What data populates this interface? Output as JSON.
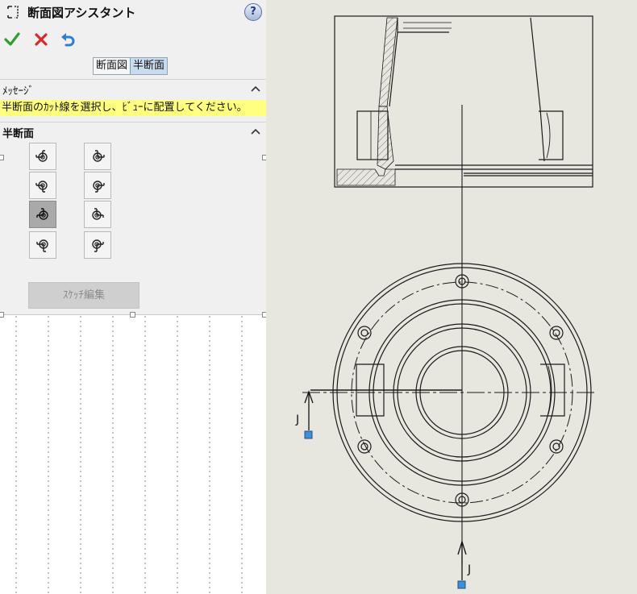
{
  "dialog": {
    "title": "断面図アシスタント",
    "help_symbol": "?",
    "tabs": [
      "断面図",
      "半断面"
    ],
    "active_tab_index": 1
  },
  "message_section": {
    "header": "ﾒｯｾｰｼﾞ",
    "text": "半断面のｶｯﾄ線を選択し、ﾋﾞｭｰに配置してください。"
  },
  "half_section": {
    "header": "半断面",
    "icon_buttons": [
      {
        "name": "half-section-option-1-icon",
        "selected": false
      },
      {
        "name": "half-section-option-2-icon",
        "selected": false
      },
      {
        "name": "half-section-option-3-icon",
        "selected": false
      },
      {
        "name": "half-section-option-4-icon",
        "selected": false
      },
      {
        "name": "half-section-option-5-icon",
        "selected": true
      },
      {
        "name": "half-section-option-6-icon",
        "selected": false
      },
      {
        "name": "half-section-option-7-icon",
        "selected": false
      },
      {
        "name": "half-section-option-8-icon",
        "selected": false
      }
    ],
    "sketch_edit_label": "ｽｹｯﾁ編集"
  },
  "drawing": {
    "section_label_left": "J",
    "section_label_bottom": "J",
    "colors": {
      "canvas_bg": "#e8e7df",
      "line": "#1a1a1a",
      "marker": "#3f8fd6",
      "message_bg": "#ffff80",
      "accept": "#2e9e2e",
      "cancel": "#d42b2b",
      "undo": "#2c7fd1"
    }
  }
}
